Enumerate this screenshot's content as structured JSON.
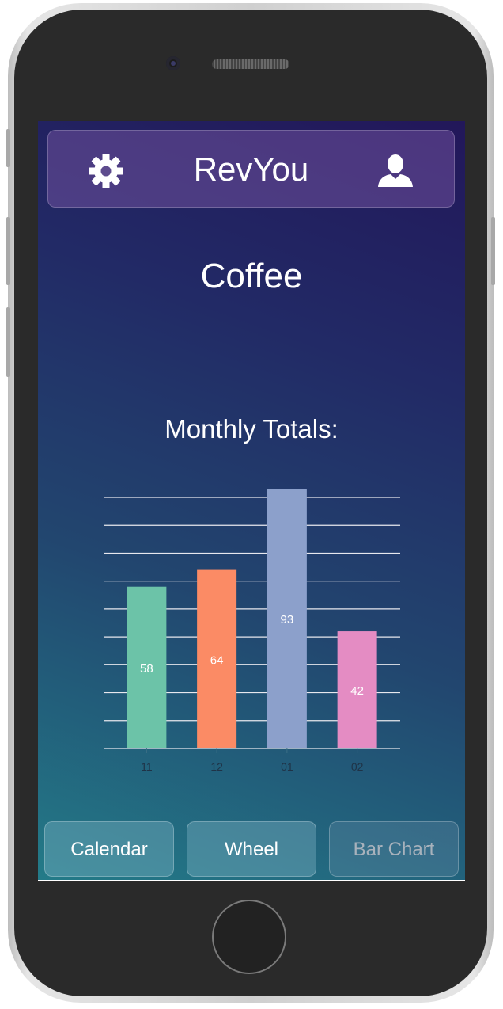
{
  "app": {
    "title": "RevYou"
  },
  "icons": {
    "settings": "gear-icon",
    "profile": "user-icon"
  },
  "page": {
    "title": "Coffee"
  },
  "chart_section": {
    "title": "Monthly Totals:"
  },
  "chart_data": {
    "type": "bar",
    "categories": [
      "11",
      "12",
      "01",
      "02"
    ],
    "values": [
      58,
      64,
      93,
      42
    ],
    "colors": [
      "#6cc3a8",
      "#fb8b65",
      "#8ca0cb",
      "#e48cc3"
    ],
    "ylim": [
      0,
      90
    ],
    "gridlines": 9,
    "grid": true
  },
  "nav": {
    "buttons": [
      {
        "label": "Calendar"
      },
      {
        "label": "Wheel"
      },
      {
        "label": "Bar Chart"
      }
    ]
  }
}
